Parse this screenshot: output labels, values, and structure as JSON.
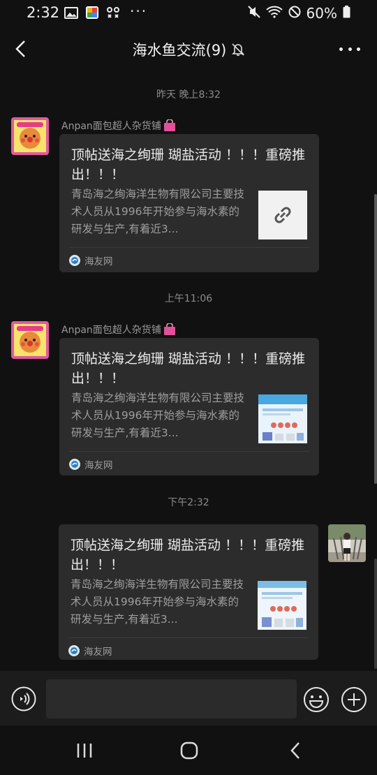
{
  "status_bar": {
    "time": "2:32",
    "more": "···",
    "battery": "60%"
  },
  "header": {
    "title": "海水鱼交流(9)"
  },
  "messages": [
    {
      "timestamp": "昨天 晚上8:32",
      "sender": "Anpan面包超人杂货铺",
      "title": "顶帖送海之绚珊 瑚盐活动 ！！！重磅推出！！！",
      "description": "青岛海之绚海洋生物有限公司主要技术人员从1996年开始参与海水素的研发与生产,有着近3...",
      "thumb_icon": "link-icon",
      "source": "海友网"
    },
    {
      "timestamp": "上午11:06",
      "sender": "Anpan面包超人杂货铺",
      "title": "顶帖送海之绚珊 瑚盐活动 ！！！重磅推出！！！",
      "description": "青岛海之绚海洋生物有限公司主要技术人员从1996年开始参与海水素的研发与生产,有着近3...",
      "thumb_icon": "product-image",
      "source": "海友网"
    },
    {
      "timestamp": "下午2:32",
      "sender": "",
      "title": "顶帖送海之绚珊 瑚盐活动 ！！！重磅推出！！！",
      "description": "青岛海之绚海洋生物有限公司主要技术人员从1996年开始参与海水素的研发与生产,有着近3...",
      "thumb_icon": "product-image",
      "source": "海友网"
    }
  ],
  "input": {
    "placeholder": ""
  },
  "colors": {
    "background": "#111111",
    "card": "#2c2c2c",
    "text": "#ececec",
    "muted": "#9e9e9e"
  }
}
